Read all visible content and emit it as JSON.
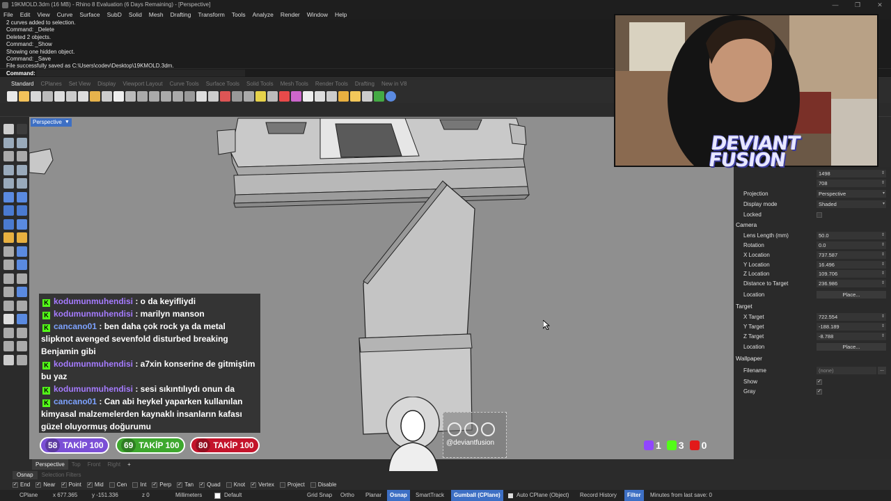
{
  "window": {
    "title": "19KMOLD.3dm (16 MB) - Rhino 8 Evaluation (6 Days Remaining) - [Perspective]",
    "controls": [
      "—",
      "❐",
      "✕"
    ]
  },
  "menu": [
    "File",
    "Edit",
    "View",
    "Curve",
    "Surface",
    "SubD",
    "Solid",
    "Mesh",
    "Drafting",
    "Transform",
    "Tools",
    "Analyze",
    "Render",
    "Window",
    "Help"
  ],
  "command_history": [
    "2 curves added to selection.",
    "Command: _Delete",
    "Deleted 2 objects.",
    "Command: _Show",
    "Showing one hidden object.",
    "Command: _Save",
    "File successfully saved as C:\\Users\\codev\\Desktop\\19KMOLD.3dm."
  ],
  "command_prompt": "Command:",
  "toolbar_tabs": [
    "Standard",
    "CPlanes",
    "Set View",
    "Display",
    "Viewport Layout",
    "Curve Tools",
    "Surface Tools",
    "Solid Tools",
    "Mesh Tools",
    "Render Tools",
    "Drafting",
    "New in V8"
  ],
  "toolbar_tabs_active": "Standard",
  "viewport": {
    "label": "Perspective",
    "tabs": [
      "Perspective",
      "Top",
      "Front",
      "Right"
    ],
    "active_tab": "Perspective",
    "add_tab": "+"
  },
  "properties": {
    "width": "1498",
    "height": "708",
    "projection_label": "Projection",
    "projection": "Perspective",
    "display_mode_label": "Display mode",
    "display_mode": "Shaded",
    "locked_label": "Locked",
    "camera_section": "Camera",
    "lens_length_label": "Lens Length (mm)",
    "lens_length": "50.0",
    "rotation_label": "Rotation",
    "rotation": "0.0",
    "x_location_label": "X Location",
    "x_location": "737.587",
    "y_location_label": "Y Location",
    "y_location": "16.496",
    "z_location_label": "Z Location",
    "z_location": "109.706",
    "distance_label": "Distance to Target",
    "distance": "236.986",
    "location_label": "Location",
    "place_label": "Place...",
    "target_section": "Target",
    "x_target_label": "X Target",
    "x_target": "722.554",
    "y_target_label": "Y Target",
    "y_target": "-188.189",
    "z_target_label": "Z Target",
    "z_target": "-8.788",
    "target_location_label": "Location",
    "target_place_label": "Place...",
    "wallpaper_section": "Wallpaper",
    "filename_label": "Filename",
    "filename": "(none)",
    "filename_more": "...",
    "show_label": "Show",
    "gray_label": "Gray"
  },
  "overlay_logo": "DEVIANT FUSION",
  "chat": [
    {
      "user": "kodumunmuhendisi",
      "text": ": o da keyifliydi",
      "color": "purple"
    },
    {
      "user": "kodumunmuhendisi",
      "text": ": marilyn manson",
      "color": "purple"
    },
    {
      "user": "cancano01",
      "text": ": ben daha çok rock ya da metal slipknot avenged sevenfold disturbed breaking Benjamin gibi",
      "color": "blue"
    },
    {
      "user": "kodumunmuhendisi",
      "text": ": a7xin konserine de gitmiştim bu yaz",
      "color": "purple"
    },
    {
      "user": "kodumunmuhendisi",
      "text": ": sesi sıkıntılıydı onun da",
      "color": "purple"
    },
    {
      "user": "cancano01",
      "text": ": Can abi heykel yaparken kullanılan kimyasal malzemelerden kaynaklı insanların kafası güzel oluyormuş doğurumu",
      "color": "blue"
    }
  ],
  "goals": [
    {
      "count": "58",
      "label": "TAKİP 100",
      "color": "#7b4fd6"
    },
    {
      "count": "69",
      "label": "TAKİP 100",
      "color": "#3ea82e"
    },
    {
      "count": "80",
      "label": "TAKİP 100",
      "color": "#c4142b"
    }
  ],
  "social": {
    "handle": "@deviantfusion",
    "twitch": "1",
    "kick": "3",
    "youtube": "0"
  },
  "osnap_tabs": [
    "Osnap",
    "Selection Filters"
  ],
  "osnaps": [
    {
      "label": "End",
      "checked": true
    },
    {
      "label": "Near",
      "checked": true
    },
    {
      "label": "Point",
      "checked": true
    },
    {
      "label": "Mid",
      "checked": true
    },
    {
      "label": "Cen",
      "checked": false
    },
    {
      "label": "Int",
      "checked": false
    },
    {
      "label": "Perp",
      "checked": true
    },
    {
      "label": "Tan",
      "checked": true
    },
    {
      "label": "Quad",
      "checked": true
    },
    {
      "label": "Knot",
      "checked": false
    },
    {
      "label": "Vertex",
      "checked": true
    },
    {
      "label": "Project",
      "checked": false
    },
    {
      "label": "Disable",
      "checked": false
    }
  ],
  "status": {
    "cplane": "CPlane",
    "x": "x 677.365",
    "y": "y -151.336",
    "z": "z 0",
    "units": "Millimeters",
    "layer": "Default",
    "grid_snap": "Grid Snap",
    "ortho": "Ortho",
    "planar": "Planar",
    "osnap": "Osnap",
    "smarttrack": "SmartTrack",
    "gumball": "Gumball (CPlane)",
    "auto_cplane": "Auto CPlane (Object)",
    "record_history": "Record History",
    "filter": "Filter",
    "save_info": "Minutes from last save: 0"
  }
}
